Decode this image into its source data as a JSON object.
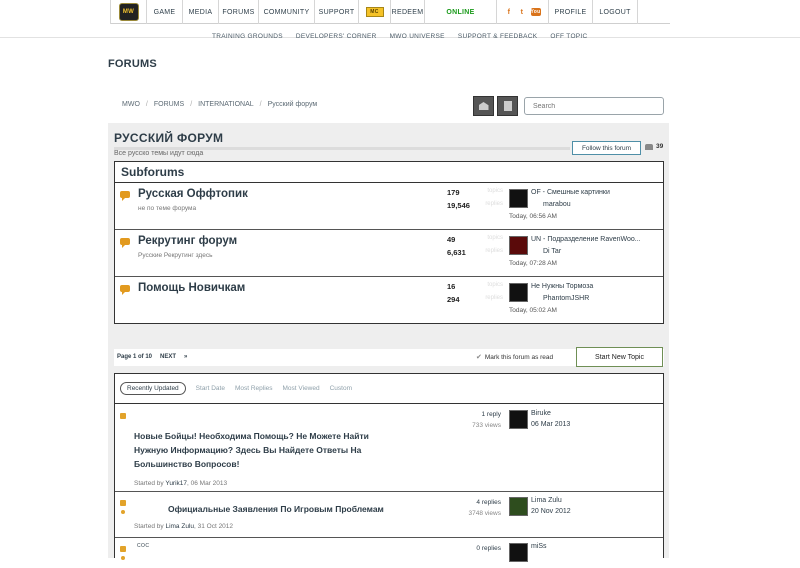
{
  "nav": {
    "logo_text": "MW",
    "items": [
      "GAME",
      "MEDIA",
      "FORUMS",
      "COMMUNITY",
      "SUPPORT"
    ],
    "mc_label": "MC",
    "redeem": "REDEEM",
    "online": "ONLINE",
    "social": [
      "f",
      "t",
      "You"
    ],
    "profile": "PROFILE",
    "logout": "LOGOUT"
  },
  "subnav": [
    "TRAINING GROUNDS",
    "DEVELOPERS' CORNER",
    "MWO UNIVERSE",
    "SUPPORT & FEEDBACK",
    "OFF TOPIC"
  ],
  "page": {
    "title": "FORUMS",
    "breadcrumb": [
      "MWO",
      "FORUMS",
      "INTERNATIONAL",
      "Русский форум"
    ],
    "search_placeholder": "Search"
  },
  "forum": {
    "title": "РУССКИЙ ФОРУМ",
    "description": "Все русско темы идут сюда",
    "follow_label": "Follow this forum",
    "follower_count": "39"
  },
  "subforums": {
    "header": "Subforums",
    "rows": [
      {
        "name": "Русская Оффтопик",
        "desc": "не по теме форума",
        "topics": "179",
        "replies": "19,546",
        "topics_label": "topics",
        "replies_label": "replies",
        "last_title": "OF - Смешные картинки",
        "last_user": "marabou",
        "last_date": "Today, 06:56 AM",
        "avatar": "dark"
      },
      {
        "name": "Рекрутинг форум",
        "desc": "Русские Рекрутинг здесь",
        "topics": "49",
        "replies": "6,631",
        "topics_label": "topics",
        "replies_label": "replies",
        "last_title": "UN - Подразделение RavenWoo...",
        "last_user": "Di Tar",
        "last_date": "Today, 07:28 AM",
        "avatar": "red"
      },
      {
        "name": "Помощь Новичкам",
        "desc": "",
        "topics": "16",
        "replies": "294",
        "topics_label": "topics",
        "replies_label": "replies",
        "last_title": "Не Нужны Тормоза",
        "last_user": "PhantomJSHR",
        "last_date": "Today, 05:02 AM",
        "avatar": "dark"
      }
    ]
  },
  "pagination": {
    "page": "Page 1 of 10",
    "next": "NEXT",
    "last": "»",
    "mark_read": "Mark this forum as read",
    "new_topic": "Start New Topic"
  },
  "tabs": [
    "Recently Updated",
    "Start Date",
    "Most Replies",
    "Most Viewed",
    "Custom"
  ],
  "topics": [
    {
      "prefix": "",
      "title_lines": [
        "Новые Бойцы! Необходима Помощь? Не Можете Найти",
        "Нужную Информацию? Здесь Вы Найдете Ответы На",
        "Большинство Вопросов!"
      ],
      "started_by": "Started by",
      "author": "Yurik17",
      "date": ", 06 Mar 2013",
      "replies": "1 reply",
      "views": "733 views",
      "last_user": "Biruke",
      "last_date": "06 Mar 2013"
    },
    {
      "prefix": "",
      "title_lines": [
        "Официальные Заявления По Игровым Проблемам"
      ],
      "started_by": "Started by",
      "author": "Lima Zulu",
      "date": ", 31 Oct 2012",
      "replies": "4 replies",
      "views": "3748 views",
      "last_user": "Lima Zulu",
      "last_date": "20 Nov 2012"
    },
    {
      "prefix": "СОС",
      "title_lines": [
        ""
      ],
      "started_by": "",
      "author": "",
      "date": "",
      "replies": "0 replies",
      "views": "",
      "last_user": "miSs",
      "last_date": ""
    }
  ]
}
